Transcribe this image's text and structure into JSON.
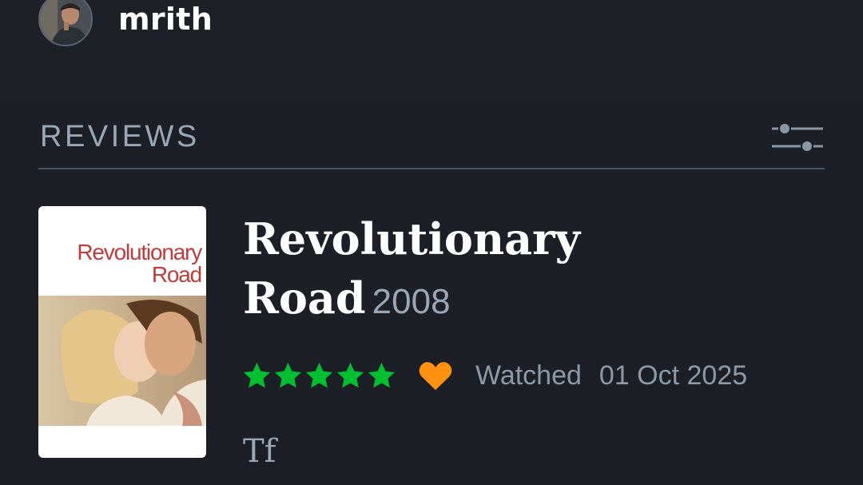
{
  "user": {
    "username": "mrith",
    "avatar_icon": "profile-photo"
  },
  "section": {
    "title": "REVIEWS",
    "filter_icon": "sliders-icon"
  },
  "review": {
    "poster_text": [
      "Revolutionary",
      "Road"
    ],
    "title_line1": "Revolutionary",
    "title_line2": "Road",
    "year": "2008",
    "rating": 5,
    "rating_max": 5,
    "liked": true,
    "watched_label": "Watched",
    "watched_date": "01 Oct 2025",
    "text": "Tf"
  },
  "colors": {
    "background": "#1c2026",
    "star": "#00c030",
    "heart": "#ff9010",
    "muted_text": "#9aa7b6",
    "divider": "#445566"
  }
}
